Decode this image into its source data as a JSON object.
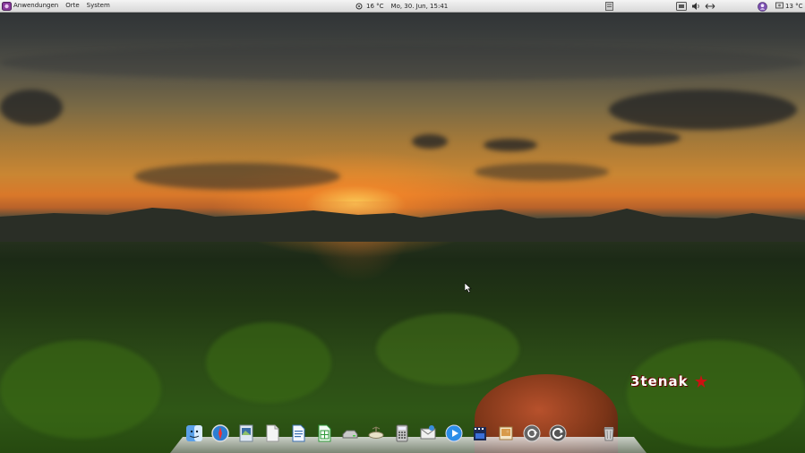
{
  "top_panel": {
    "menu": [
      "Anwendungen",
      "Orte",
      "System"
    ],
    "weather_center": "16 °C",
    "datetime": "Mo, 30. Jun, 15:41",
    "weather_right": "13 °C"
  },
  "dock": {
    "icons": [
      "finder-icon",
      "safari-icon",
      "preview-icon",
      "document-icon",
      "writer-icon",
      "spreadsheet-icon",
      "drive-icon",
      "lamp-icon",
      "calculator-icon",
      "mail-icon",
      "media-player-icon",
      "clapperboard-icon",
      "photo-icon",
      "sync-icon",
      "refresh-icon",
      "trash-icon"
    ]
  },
  "logo_text": "3tenak",
  "colors": {
    "panel_bg": "#e6e6e6",
    "accent": "#cc1111"
  }
}
